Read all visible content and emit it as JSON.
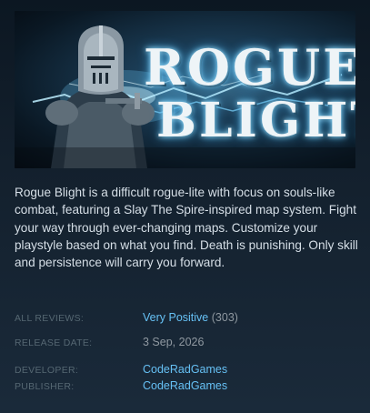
{
  "capsule": {
    "logo_line1": "ROGUE",
    "logo_line2": "BLIGHT"
  },
  "description": "Rogue Blight is a difficult rogue-lite with focus on souls-like combat, featuring a Slay The Spire-inspired map system. Fight your way through ever-changing maps. Customize your playstyle based on what you find. Death is punishing. Only skill and persistence will carry you forward.",
  "reviews": {
    "label": "ALL REVIEWS:",
    "summary": "Very Positive",
    "count": "(303)"
  },
  "release": {
    "label": "RELEASE DATE:",
    "date": "3 Sep, 2026"
  },
  "developer": {
    "label": "DEVELOPER:",
    "name": "CodeRadGames"
  },
  "publisher": {
    "label": "PUBLISHER:",
    "name": "CodeRadGames"
  },
  "colors": {
    "background": "#1b2838",
    "link": "#66c0f4",
    "label": "#556772",
    "text": "#d6dfe7"
  }
}
